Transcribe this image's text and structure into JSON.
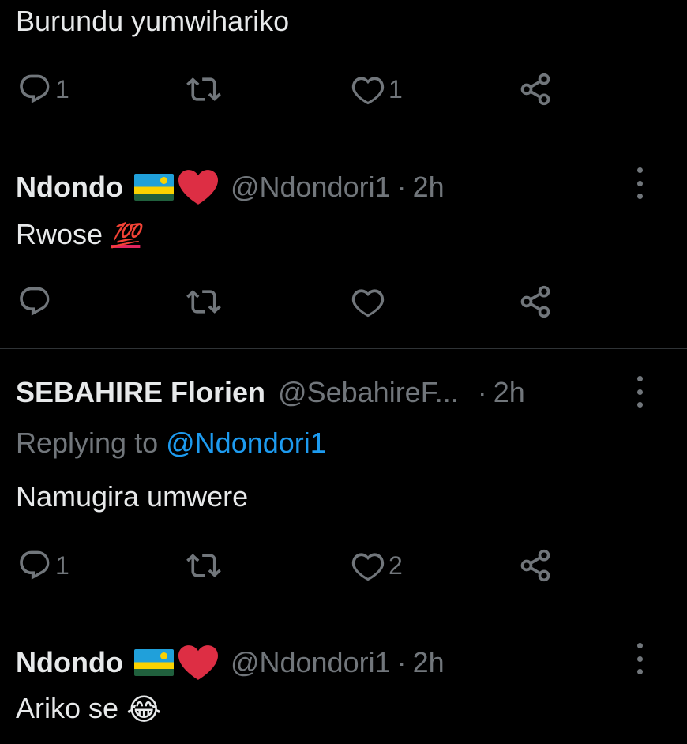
{
  "tweets": [
    {
      "text": "Burundu yumwihariko",
      "replies": "1",
      "retweets": "",
      "likes": "1"
    },
    {
      "name": "Ndondo",
      "handle": "@Ndondori1",
      "dot": "·",
      "time": "2h",
      "text": "Rwose",
      "emoji": "💯",
      "replies": "",
      "retweets": "",
      "likes": ""
    },
    {
      "name": "SEBAHIRE Florien",
      "handle": "@SebahireF...",
      "dot": "·",
      "time": "2h",
      "replying_prefix": "Replying to",
      "replying_handle": "@Ndondori1",
      "text": "Namugira umwere",
      "replies": "1",
      "retweets": "",
      "likes": "2"
    },
    {
      "name": "Ndondo",
      "handle": "@Ndondori1",
      "dot": "·",
      "time": "2h",
      "text": "Ariko se",
      "emoji": "😂"
    }
  ],
  "icons": {
    "reply": "reply-icon",
    "retweet": "retweet-icon",
    "like": "heart-icon",
    "share": "share-icon",
    "more": "more-icon",
    "flag": "rwanda-flag-icon"
  },
  "colors": {
    "background": "#000000",
    "text": "#e7e9ea",
    "secondary": "#71767b",
    "link": "#1d9bf0",
    "heart_emoji": "#e0245e"
  }
}
